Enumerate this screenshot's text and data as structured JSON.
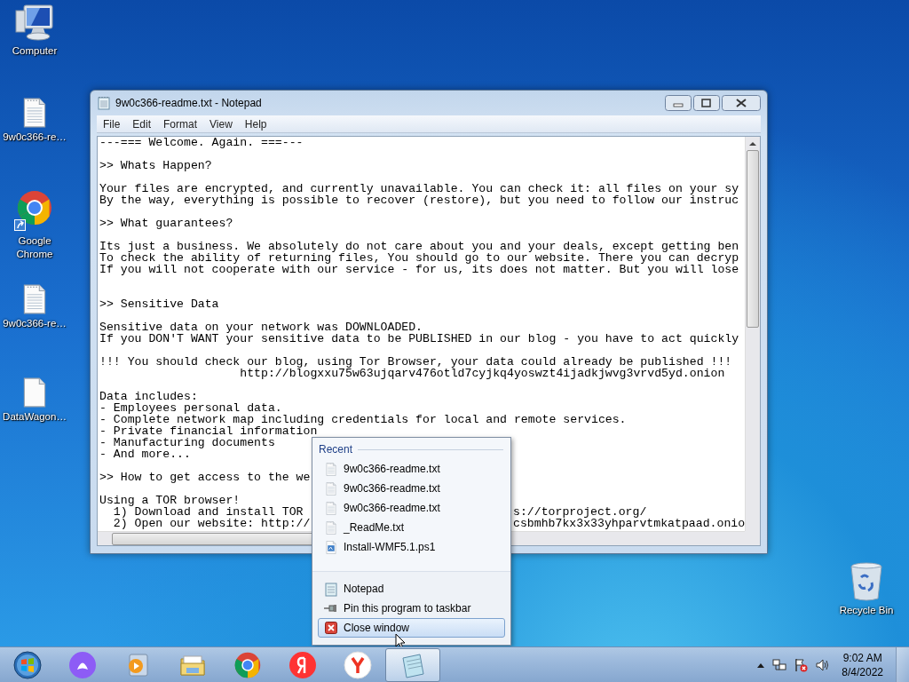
{
  "desktop_icons": [
    {
      "label": "Computer",
      "kind": "computer"
    },
    {
      "label": "9w0c366-re…",
      "kind": "text-file"
    },
    {
      "label": "Google Chrome",
      "kind": "chrome"
    },
    {
      "label": "9w0c366-re…",
      "kind": "text-file"
    },
    {
      "label": "DataWagon…",
      "kind": "blank-file"
    },
    {
      "label": "Recycle Bin",
      "kind": "recycle-bin"
    }
  ],
  "window": {
    "title": "9w0c366-readme.txt - Notepad",
    "menu": [
      "File",
      "Edit",
      "Format",
      "View",
      "Help"
    ],
    "lines": [
      {
        "kind": "text",
        "text": "---=== Welcome. Again. ===---"
      },
      {
        "kind": "blank"
      },
      {
        "kind": "text",
        "text": ">> Whats Happen?"
      },
      {
        "kind": "blank"
      },
      {
        "kind": "text",
        "text": "Your files are encrypted, and currently unavailable. You can check it: all files on your sy"
      },
      {
        "kind": "text",
        "text": "By the way, everything is possible to recover (restore), but you need to follow our instruc"
      },
      {
        "kind": "blank"
      },
      {
        "kind": "text",
        "text": ">> What guarantees?"
      },
      {
        "kind": "blank"
      },
      {
        "kind": "text",
        "text": "Its just a business. We absolutely do not care about you and your deals, except getting ben"
      },
      {
        "kind": "text",
        "text": "To check the ability of returning files, You should go to our website. There you can decryp"
      },
      {
        "kind": "text",
        "text": "If you will not cooperate with our service - for us, its does not matter. But you will lose"
      },
      {
        "kind": "blank"
      },
      {
        "kind": "blank"
      },
      {
        "kind": "text",
        "text": ">> Sensitive Data"
      },
      {
        "kind": "blank"
      },
      {
        "kind": "text",
        "text": "Sensitive data on your network was DOWNLOADED."
      },
      {
        "kind": "text",
        "text": "If you DON'T WANT your sensitive data to be PUBLISHED in our blog - you have to act quickly"
      },
      {
        "kind": "blank"
      },
      {
        "kind": "text",
        "text": "!!! You should check our blog, using Tor Browser, your data could already be published !!!"
      },
      {
        "kind": "text",
        "text": "                    http://blogxxu75w63ujqarv476otld7cyjkq4yoswzt4ijadkjwvg3vrvd5yd.onion"
      },
      {
        "kind": "blank"
      },
      {
        "kind": "text",
        "text": "Data includes:"
      },
      {
        "kind": "text",
        "text": "- Employees personal data."
      },
      {
        "kind": "text",
        "text": "- Complete network map including credentials for local and remote services."
      },
      {
        "kind": "text",
        "text": "- Private financial information"
      },
      {
        "kind": "text",
        "text": "- Manufacturing documents"
      },
      {
        "kind": "text",
        "text": "- And more..."
      },
      {
        "kind": "blank"
      },
      {
        "kind": "text",
        "text": ">> How to get access to the we"
      },
      {
        "kind": "blank"
      },
      {
        "kind": "text",
        "text": "Using a TOR browser!"
      },
      {
        "kind": "text",
        "text": "  1) Download and install TOR",
        "tail": "s://torproject.org/"
      },
      {
        "kind": "text",
        "text": "  2) Open our website: http://",
        "tail": "csbmhb7kx3x33yhparvtmkatpaad.onio"
      }
    ]
  },
  "jump_list": {
    "header": "Recent",
    "recent": [
      {
        "label": "9w0c366-readme.txt",
        "kind": "text"
      },
      {
        "label": "9w0c366-readme.txt",
        "kind": "text"
      },
      {
        "label": "9w0c366-readme.txt",
        "kind": "text"
      },
      {
        "label": "_ReadMe.txt",
        "kind": "text"
      },
      {
        "label": "Install-WMF5.1.ps1",
        "kind": "script"
      }
    ],
    "tasks": [
      {
        "label": "Notepad",
        "kind": "app",
        "selected": false
      },
      {
        "label": "Pin this program to taskbar",
        "kind": "pin",
        "selected": false
      },
      {
        "label": "Close window",
        "kind": "close",
        "selected": true
      }
    ]
  },
  "taskbar": {
    "items": [
      {
        "kind": "start",
        "selected": false
      },
      {
        "kind": "alice",
        "selected": false
      },
      {
        "kind": "media",
        "selected": false
      },
      {
        "kind": "explorer",
        "selected": false
      },
      {
        "kind": "chrome",
        "selected": false
      },
      {
        "kind": "yandex",
        "selected": false
      },
      {
        "kind": "yandex-browser",
        "selected": false
      },
      {
        "kind": "notepad",
        "selected": true
      }
    ],
    "tray": {
      "time": "9:02 AM",
      "date": "8/4/2022"
    }
  }
}
